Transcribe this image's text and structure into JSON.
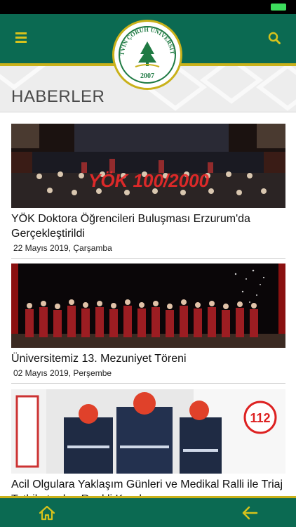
{
  "app": {
    "logo_top_text": "ARTVİN ÇORUH ÜNİVERSİTESİ",
    "logo_year": "2007"
  },
  "header": {
    "menu_icon": "hamburger-menu-icon",
    "search_icon": "search-icon"
  },
  "page": {
    "title": "HABERLER"
  },
  "news": [
    {
      "title": "YÖK Doktora Öğrencileri Buluşması Erzurum'da Gerçekleştirildi",
      "date": "22 Mayıs 2019, Çarşamba",
      "image_caption": "YÖK 100/2000"
    },
    {
      "title": "Üniversitemiz 13. Mezuniyet Töreni",
      "date": "02 Mayıs 2019, Perşembe"
    },
    {
      "title": "Acil Olgulara Yaklaşım Günleri ve Medikal Ralli ile Triaj Tatbikatından Renkli Kareler",
      "date": ""
    }
  ],
  "bottom_bar": {
    "home_icon": "home-icon",
    "back_icon": "back-arrow-icon"
  },
  "colors": {
    "primary": "#0b6a52",
    "accent": "#c9b11a",
    "battery": "#3ddc5c"
  }
}
